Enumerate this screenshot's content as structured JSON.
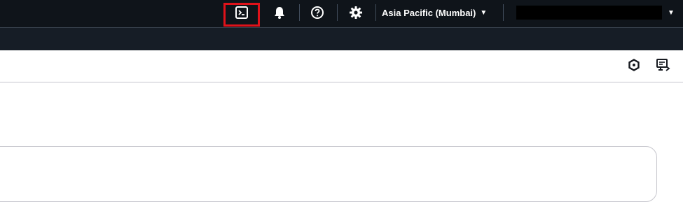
{
  "topbar": {
    "cloudshell_icon": "cloudshell-icon",
    "notifications_icon": "bell-icon",
    "help_icon": "help-icon",
    "settings_icon": "gear-icon",
    "region_label": "Asia Pacific (Mumbai)",
    "region_caret": "▼",
    "account_caret": "▼",
    "highlight_color": "#e0121a"
  },
  "pane_toolbar": {
    "left_icon": "hexagon-icon",
    "right_icon": "screen-feedback-icon"
  },
  "colors": {
    "topbar_bg": "#0f141a",
    "subbar_bg": "#161d26",
    "border": "#c6c6cd"
  }
}
